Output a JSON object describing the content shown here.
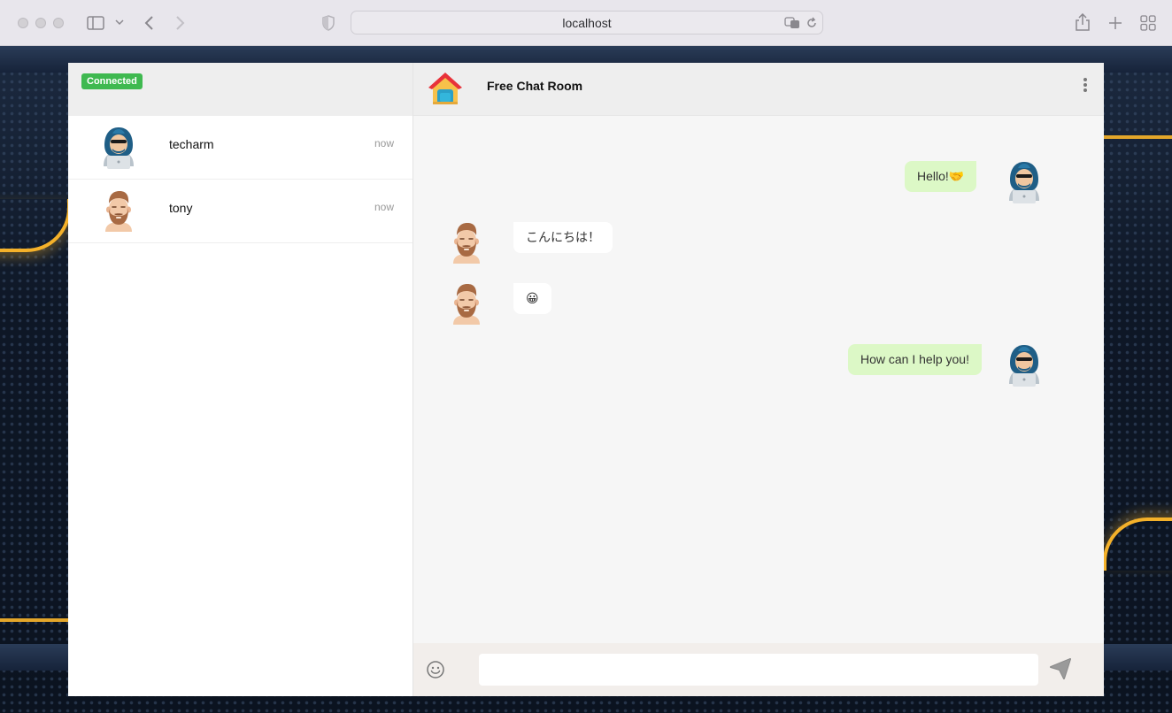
{
  "browser": {
    "url": "localhost"
  },
  "sidebar": {
    "status_badge": "Connected",
    "contacts": [
      {
        "name": "techarm",
        "time": "now",
        "avatar": "hooded-hacker-avatar"
      },
      {
        "name": "tony",
        "time": "now",
        "avatar": "bearded-man-avatar"
      }
    ]
  },
  "chat": {
    "room_icon": "house-icon",
    "title": "Free Chat Room",
    "messages": [
      {
        "direction": "out",
        "text": "Hello!🤝",
        "sender": "techarm"
      },
      {
        "direction": "in",
        "text": "こんにちは！",
        "sender": "tony"
      },
      {
        "direction": "in",
        "text": "😀",
        "sender": "tony"
      },
      {
        "direction": "out",
        "text": "How can I help you!",
        "sender": "techarm"
      }
    ],
    "input_value": "",
    "input_placeholder": ""
  },
  "colors": {
    "connected": "#3fb950",
    "outgoing_bubble": "#dcf8c6",
    "incoming_bubble": "#ffffff",
    "accent_gold": "#f4b12a"
  }
}
